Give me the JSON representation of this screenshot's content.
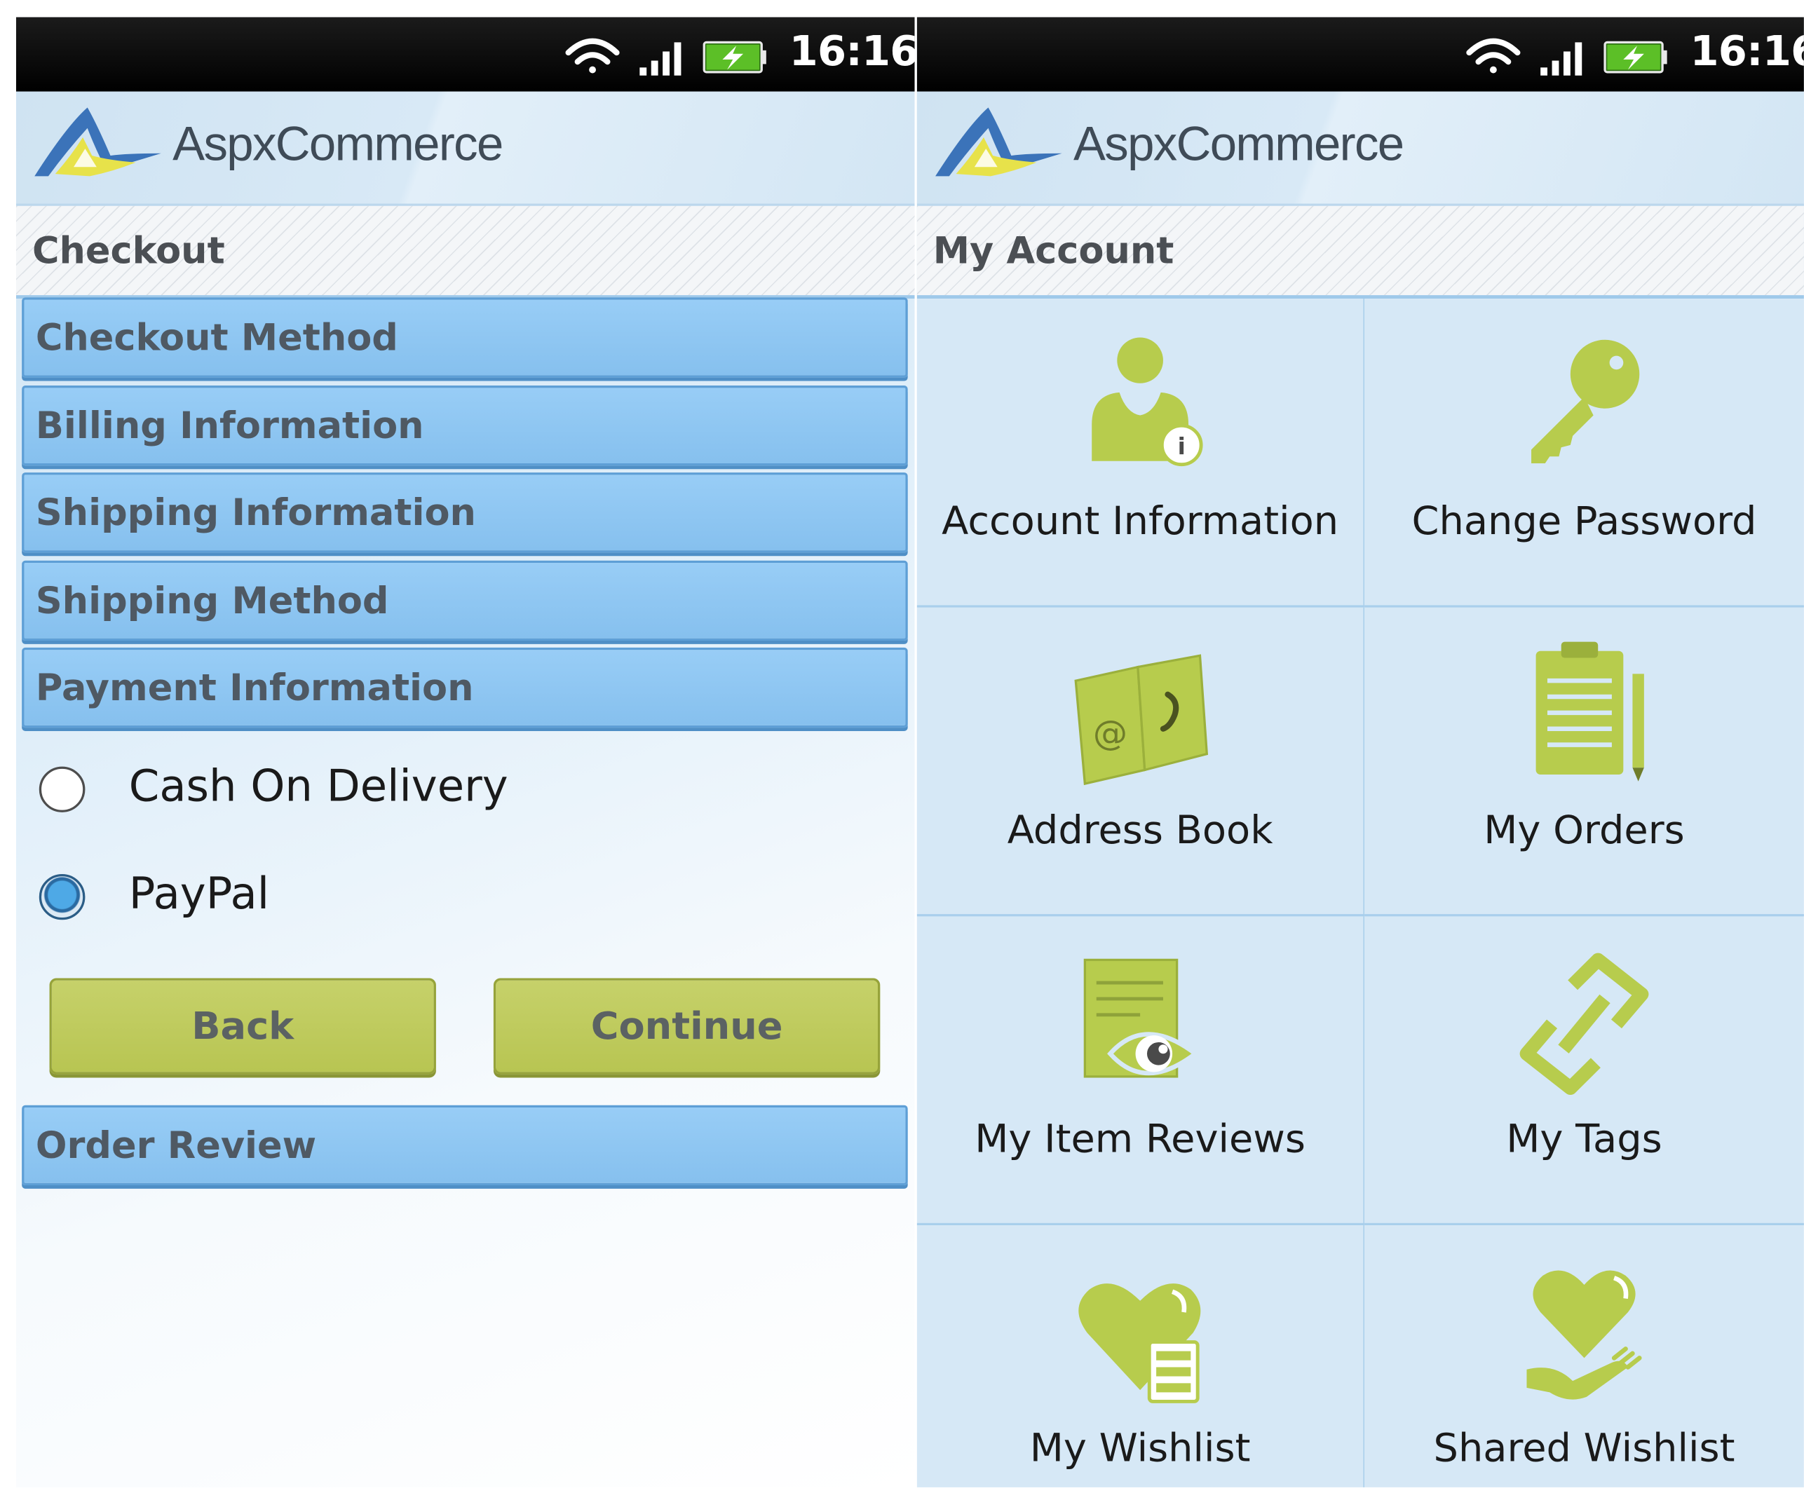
{
  "status_bar": {
    "time": "16:16"
  },
  "app": {
    "logo_text": "AspxCommerce"
  },
  "checkout": {
    "title": "Checkout",
    "sections": [
      {
        "label": "Checkout Method"
      },
      {
        "label": "Billing Information"
      },
      {
        "label": "Shipping Information"
      },
      {
        "label": "Shipping Method"
      },
      {
        "label": "Payment Information"
      }
    ],
    "payment_options": [
      {
        "label": "Cash On Delivery",
        "selected": false
      },
      {
        "label": "PayPal",
        "selected": true
      }
    ],
    "back_label": "Back",
    "continue_label": "Continue",
    "order_review_label": "Order Review"
  },
  "account": {
    "title": "My Account",
    "tiles": [
      {
        "label": "Account Information",
        "icon": "user-info-icon"
      },
      {
        "label": "Change Password",
        "icon": "key-icon"
      },
      {
        "label": "Address Book",
        "icon": "address-book-icon"
      },
      {
        "label": "My Orders",
        "icon": "clipboard-icon"
      },
      {
        "label": "My Item Reviews",
        "icon": "review-eye-icon"
      },
      {
        "label": "My Tags",
        "icon": "tag-link-icon"
      },
      {
        "label": "My Wishlist",
        "icon": "heart-list-icon"
      },
      {
        "label": "Shared Wishlist",
        "icon": "heart-hand-icon"
      }
    ]
  },
  "colors": {
    "section_blue": "#8ec6f2",
    "button_green": "#bccb58",
    "icon_green": "#b7cc4d",
    "header_blue": "#d3e6f4"
  }
}
